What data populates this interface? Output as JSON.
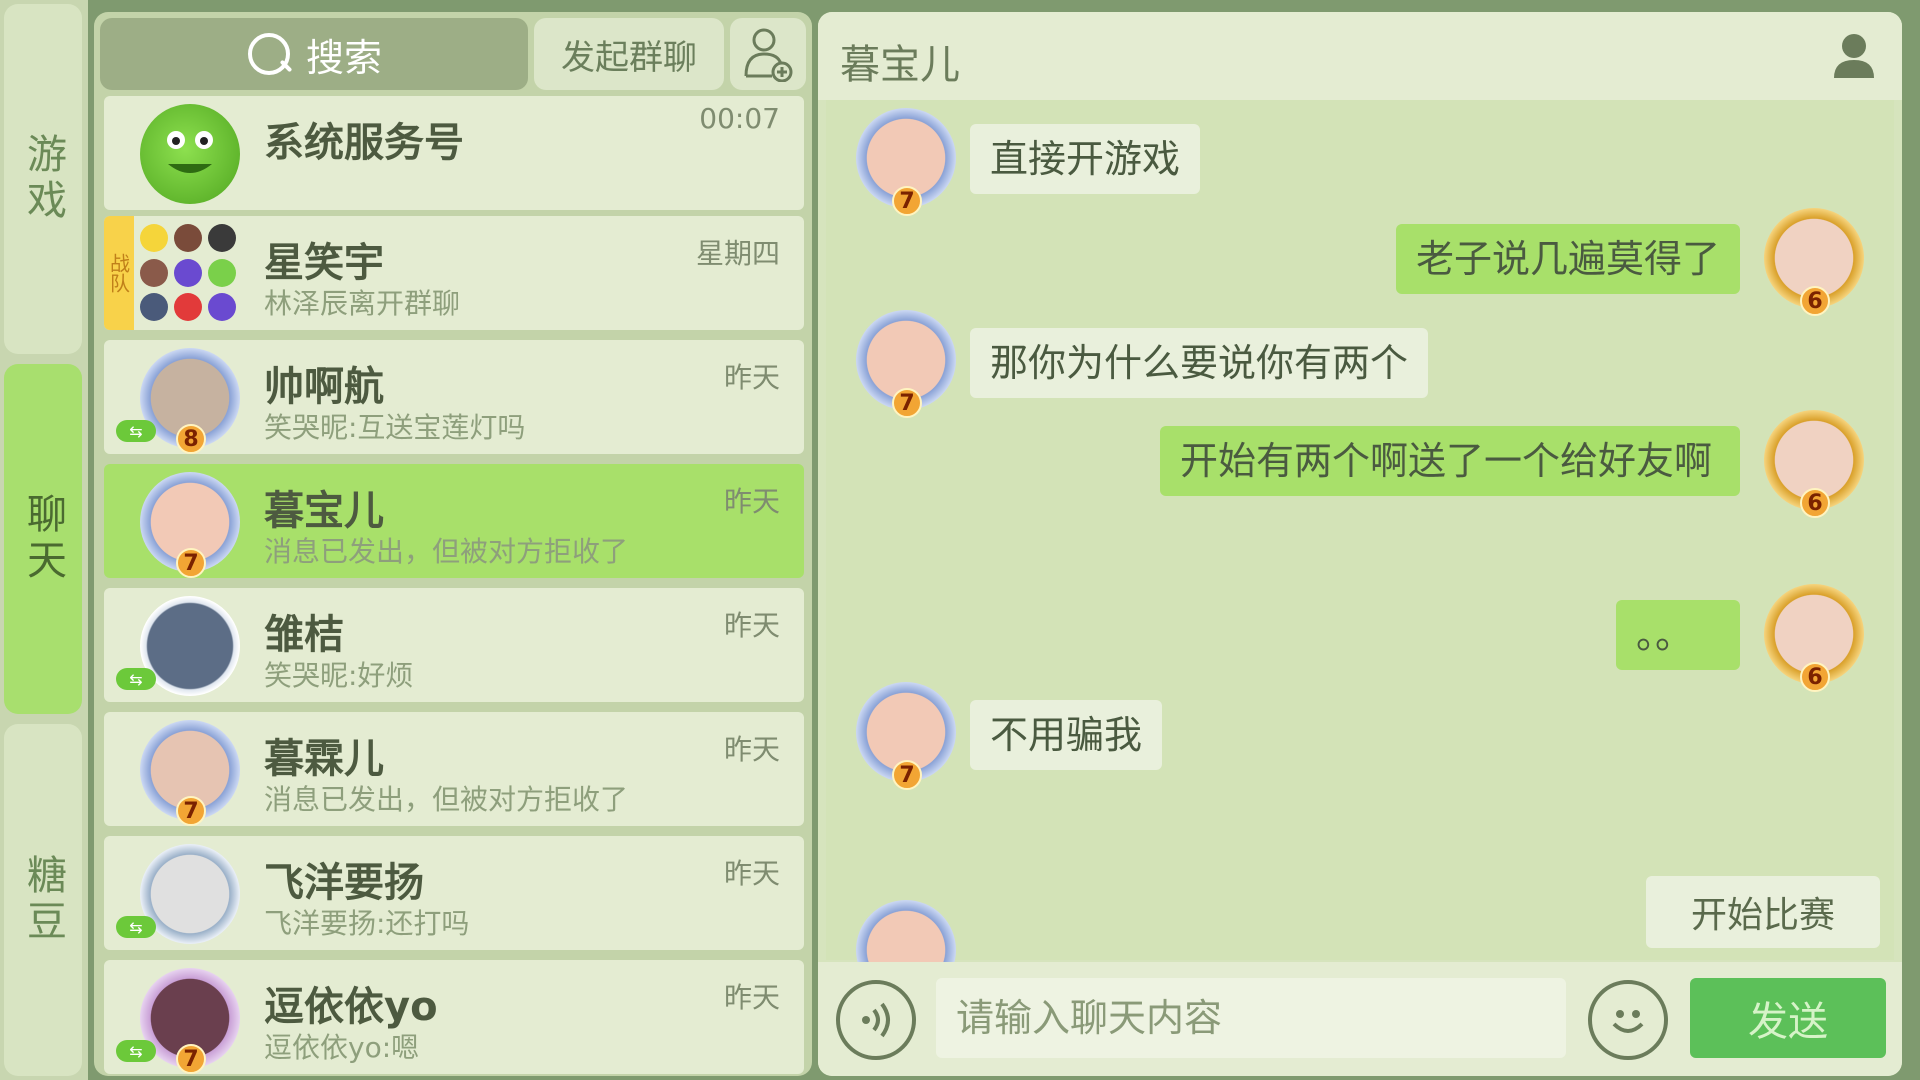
{
  "side_tabs": [
    {
      "label": "游戏",
      "active": false
    },
    {
      "label": "聊天",
      "active": true
    },
    {
      "label": "糖豆",
      "active": false
    }
  ],
  "search": {
    "label": "搜索"
  },
  "group_chat_button": "发起群聊",
  "conversations": [
    {
      "name": "系统服务号",
      "preview": "",
      "time": "00:07",
      "level": null,
      "avatar_color": "#6fcf3a"
    },
    {
      "name": "星笑宇",
      "preview": "林泽辰离开群聊",
      "time": "星期四",
      "team_tag": "战队",
      "is_group": true
    },
    {
      "name": "帅啊航",
      "preview": "笑哭昵:互送宝莲灯吗",
      "time": "昨天",
      "level": "8",
      "online": true,
      "avatar_color": "#b59a86"
    },
    {
      "name": "暮宝儿",
      "preview": "消息已发出，但被对方拒收了",
      "time": "昨天",
      "level": "7",
      "selected": true,
      "avatar_color": "#f2c9b6"
    },
    {
      "name": "雏桔",
      "preview": "笑哭昵:好烦",
      "time": "昨天",
      "online": true,
      "avatar_color": "#5c6d86"
    },
    {
      "name": "暮霖儿",
      "preview": "消息已发出，但被对方拒收了",
      "time": "昨天",
      "level": "7",
      "avatar_color": "#e6c4b2"
    },
    {
      "name": "飞洋要扬",
      "preview": "飞洋要扬:还打吗",
      "time": "昨天",
      "online": true,
      "avatar_color": "#d9d9d9"
    },
    {
      "name": "逗依依yo",
      "preview": "逗依依yo:嗯",
      "time": "昨天",
      "level": "7",
      "online": true,
      "avatar_color": "#6a3f4e"
    }
  ],
  "chat": {
    "title": "暮宝儿",
    "messages": [
      {
        "side": "left",
        "text": "直接开游戏",
        "level": "7"
      },
      {
        "side": "right",
        "text": "老子说几遍莫得了",
        "level": "6"
      },
      {
        "side": "left",
        "text": "那你为什么要说你有两个",
        "level": "7"
      },
      {
        "side": "right",
        "text": "开始有两个啊送了一个给好友啊",
        "level": "6"
      },
      {
        "side": "right",
        "text": "。。",
        "level": "6"
      },
      {
        "side": "left",
        "text": "不用骗我",
        "level": "7"
      }
    ],
    "start_match": "开始比赛",
    "input_placeholder": "请输入聊天内容",
    "send": "发送"
  }
}
